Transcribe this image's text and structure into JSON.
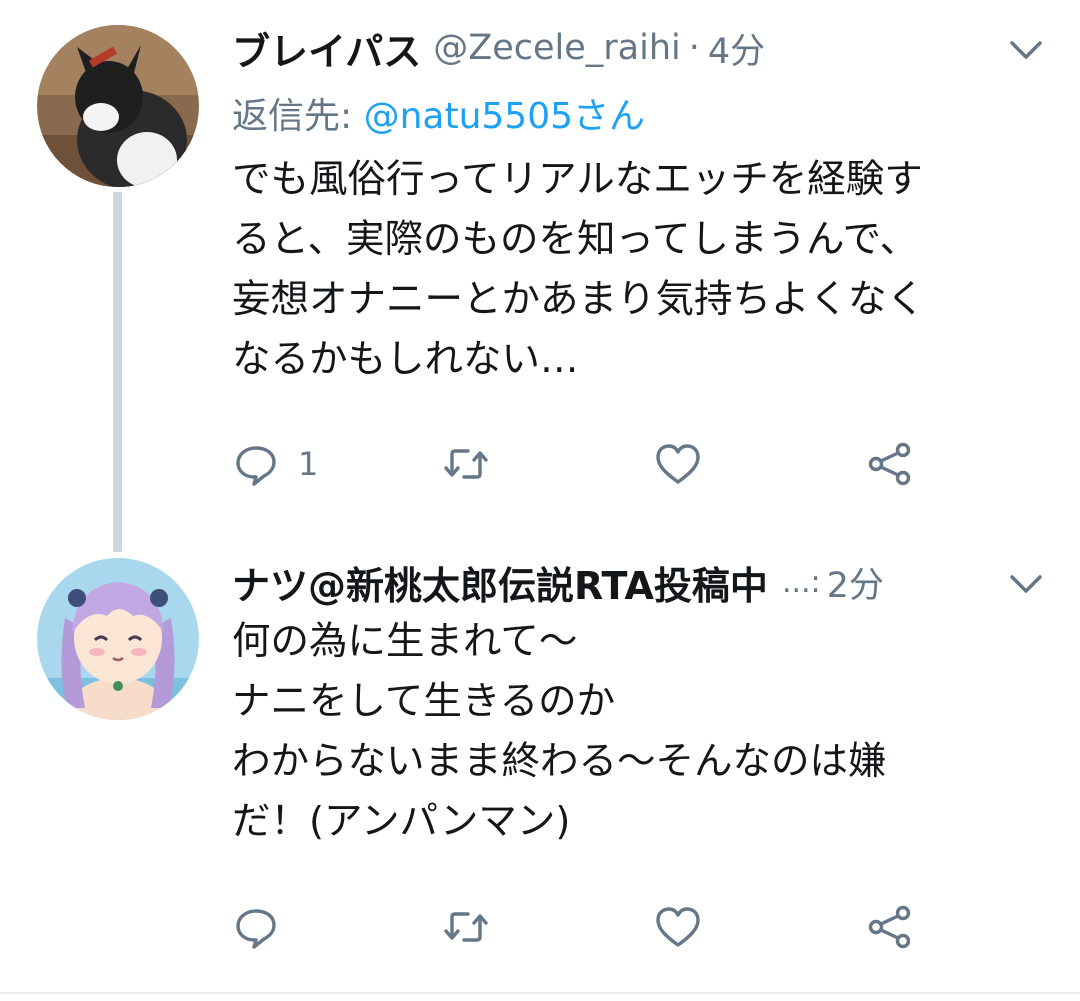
{
  "tweets": [
    {
      "display_name": "ブレイパス",
      "handle": "@Zecele_raihi",
      "separator": "·",
      "time": "4分",
      "reply_label": "返信先:",
      "reply_mention": "@natu5505さん",
      "body_lines": [
        "でも風俗行ってリアルなエッチを経験す",
        "ると、実際のものを知ってしまうんで、",
        "妄想オナニーとかあまり気持ちよくなく",
        "なるかもしれない…"
      ],
      "reply_count": "1",
      "avatar_icon": "cat-photo-avatar"
    },
    {
      "display_name": "ナツ@新桃太郎伝説RTA投稿中",
      "truncation": "...:",
      "time": "2分",
      "body_lines": [
        "何の為に生まれて〜",
        "ナニをして生きるのか",
        "わからないまま終わる〜そんなのは嫌",
        "だ！(アンパンマン)"
      ],
      "reply_count": "",
      "avatar_icon": "anime-girl-avatar"
    }
  ],
  "colors": {
    "text": "#14171a",
    "secondary": "#657786",
    "link": "#1da1f2",
    "thread_line": "#ccd6dd"
  },
  "icons": [
    "chevron-down-icon",
    "reply-icon",
    "retweet-icon",
    "like-icon",
    "share-icon"
  ]
}
